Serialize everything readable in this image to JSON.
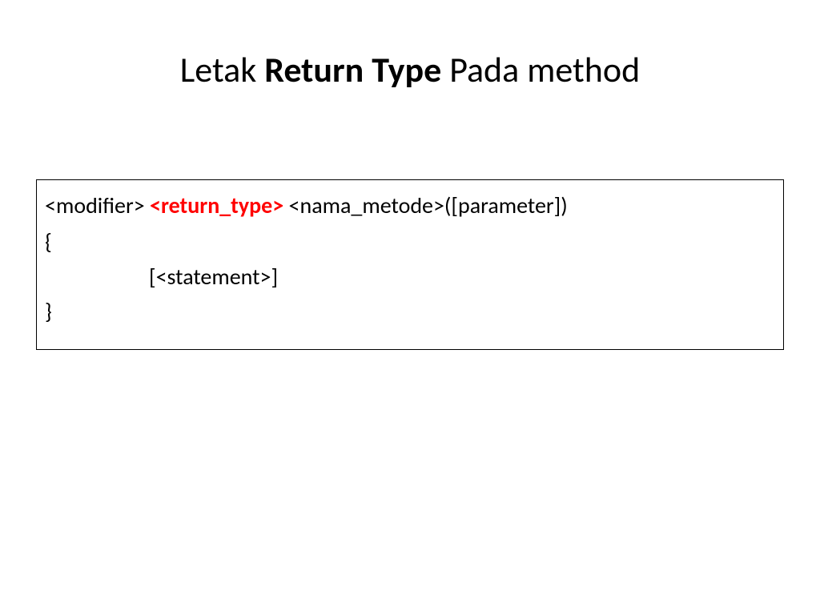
{
  "title": {
    "part1": "Letak ",
    "bold": "Return Type",
    "part2": " Pada method"
  },
  "codebox": {
    "modifier": "<modifier> ",
    "return_type": "<return_type>",
    "rest_line1": " <nama_metode>([parameter])",
    "open_brace": "{",
    "statement": "[<statement>]",
    "close_brace": "}"
  }
}
